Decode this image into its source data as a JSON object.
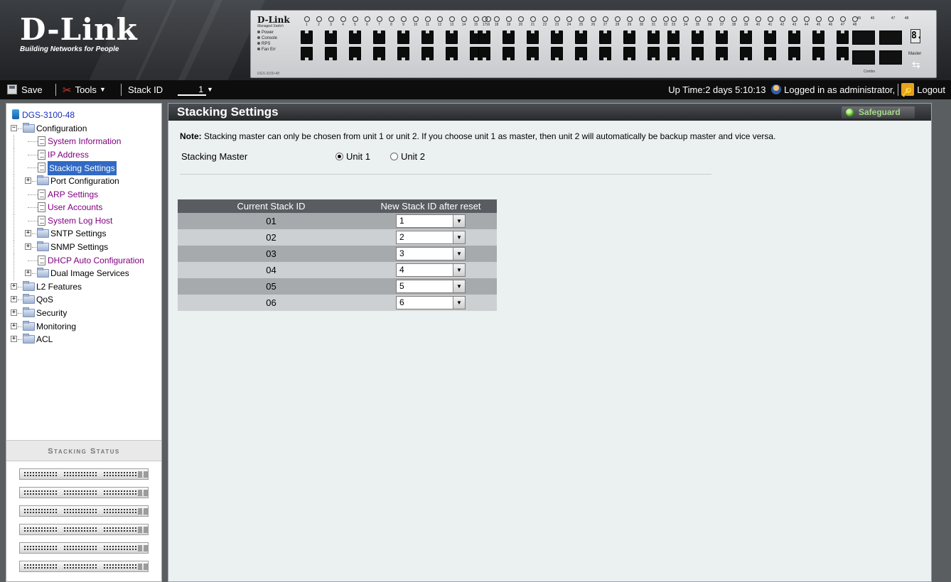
{
  "brand": {
    "logo_text": "D-Link",
    "tagline": "Building Networks for People"
  },
  "device_panel": {
    "brand": "D-Link",
    "subtitle": "Managed Switch",
    "leds": [
      "Power",
      "Console",
      "RPS",
      "Fan Err"
    ],
    "model": "DGS-3100-48",
    "port_groups": [
      {
        "numbers": [
          "1",
          "2",
          "3",
          "4",
          "5",
          "6",
          "7",
          "8",
          "9",
          "10",
          "11",
          "12",
          "13",
          "14",
          "15",
          "16"
        ]
      },
      {
        "numbers": [
          "17",
          "18",
          "19",
          "20",
          "21",
          "22",
          "23",
          "24",
          "25",
          "26",
          "27",
          "28",
          "29",
          "30",
          "31",
          "32"
        ]
      },
      {
        "numbers": [
          "33",
          "34",
          "35",
          "36",
          "37",
          "38",
          "39",
          "40",
          "41",
          "42",
          "43",
          "44",
          "45",
          "46",
          "47",
          "48"
        ]
      }
    ],
    "combo_numbers": [
      "45",
      "46",
      "47",
      "48"
    ],
    "combo_label": "Combo",
    "unit_display": "8.",
    "master_label": "Master"
  },
  "toolbar": {
    "save_label": "Save",
    "tools_label": "Tools",
    "stack_id_label": "Stack ID",
    "stack_id_value": "1",
    "uptime": "Up Time:2 days 5:10:13",
    "logged_in": "Logged in as administrator,",
    "logout_label": "Logout"
  },
  "sidebar": {
    "tree": [
      {
        "label": "DGS-3100-48",
        "level": 0,
        "type": "root"
      },
      {
        "label": "Configuration",
        "level": 0,
        "type": "folder",
        "expanded": true
      },
      {
        "label": "System Information",
        "level": 1,
        "type": "doc",
        "style": "link"
      },
      {
        "label": "IP Address",
        "level": 1,
        "type": "doc",
        "style": "link"
      },
      {
        "label": "Stacking Settings",
        "level": 1,
        "type": "doc",
        "style": "selected"
      },
      {
        "label": "Port Configuration",
        "level": 1,
        "type": "folder",
        "expanded": false
      },
      {
        "label": "ARP Settings",
        "level": 1,
        "type": "doc",
        "style": "link"
      },
      {
        "label": "User Accounts",
        "level": 1,
        "type": "doc",
        "style": "link"
      },
      {
        "label": "System Log Host",
        "level": 1,
        "type": "doc",
        "style": "link"
      },
      {
        "label": "SNTP Settings",
        "level": 1,
        "type": "folder",
        "expanded": false
      },
      {
        "label": "SNMP Settings",
        "level": 1,
        "type": "folder",
        "expanded": false
      },
      {
        "label": "DHCP Auto Configuration",
        "level": 1,
        "type": "doc",
        "style": "link"
      },
      {
        "label": "Dual Image Services",
        "level": 1,
        "type": "folder",
        "expanded": false
      },
      {
        "label": "L2 Features",
        "level": 0,
        "type": "folder",
        "expanded": false
      },
      {
        "label": "QoS",
        "level": 0,
        "type": "folder",
        "expanded": false
      },
      {
        "label": "Security",
        "level": 0,
        "type": "folder",
        "expanded": false
      },
      {
        "label": "Monitoring",
        "level": 0,
        "type": "folder",
        "expanded": false
      },
      {
        "label": "ACL",
        "level": 0,
        "type": "folder",
        "expanded": false
      }
    ],
    "stacking_status_title": "Stacking Status",
    "stack_unit_count": 6
  },
  "main": {
    "title": "Stacking Settings",
    "safeguard_label": "Safeguard",
    "note_label": "Note:",
    "note_text": " Stacking master can only be chosen from unit 1 or unit 2. If you choose unit 1 as master, then unit 2 will automatically be backup master and vice versa.",
    "stacking_master_label": "Stacking Master",
    "master_options": [
      {
        "label": "Unit 1",
        "selected": true
      },
      {
        "label": "Unit 2",
        "selected": false
      }
    ],
    "table": {
      "headers": [
        "Current Stack ID",
        "New Stack ID after reset"
      ],
      "rows": [
        {
          "current": "01",
          "new": "1"
        },
        {
          "current": "02",
          "new": "2"
        },
        {
          "current": "03",
          "new": "3"
        },
        {
          "current": "04",
          "new": "4"
        },
        {
          "current": "05",
          "new": "5"
        },
        {
          "current": "06",
          "new": "6"
        }
      ]
    }
  }
}
